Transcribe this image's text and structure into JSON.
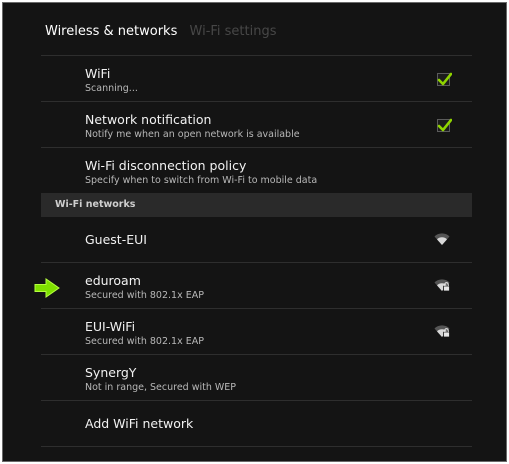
{
  "header": {
    "breadcrumb_active": "Wireless & networks",
    "breadcrumb_inactive": "Wi-Fi settings"
  },
  "settings": [
    {
      "title": "WiFi",
      "subtitle": "Scanning...",
      "checked": true
    },
    {
      "title": "Network notification",
      "subtitle": "Notify me when an open network is available",
      "checked": true
    },
    {
      "title": "Wi-Fi disconnection policy",
      "subtitle": "Specify when to switch from Wi-Fi to mobile data"
    }
  ],
  "networks_section": {
    "label": "Wi-Fi networks",
    "networks": [
      {
        "name": "Guest-EUI",
        "status": "",
        "icon": "wifi-signal-icon"
      },
      {
        "name": "eduroam",
        "status": "Secured with 802.1x EAP",
        "icon": "wifi-secured-icon"
      },
      {
        "name": "EUI-WiFi",
        "status": "Secured with 802.1x EAP",
        "icon": "wifi-secured-icon"
      },
      {
        "name": "SynergY",
        "status": "Not in range, Secured with WEP"
      }
    ],
    "add_network_label": "Add WiFi network"
  },
  "colors": {
    "background": "#141414",
    "check_accent": "#8fd400",
    "pointer_arrow": "#7fe000"
  }
}
